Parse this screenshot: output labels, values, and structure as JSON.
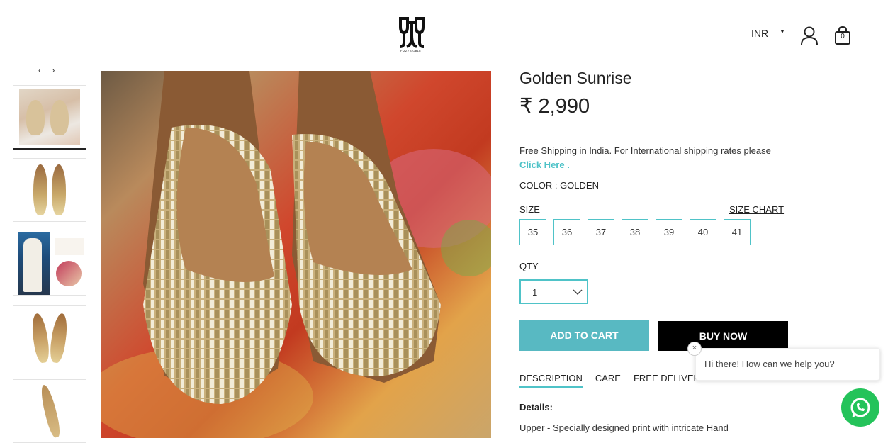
{
  "header": {
    "logo_text": "FIZZY GOBLET",
    "currency": "INR",
    "cart_count": "0"
  },
  "thumbnails": {
    "prev_icon": "chevron-left-icon",
    "next_icon": "chevron-right-icon",
    "items": [
      "thumbnail-1",
      "thumbnail-2",
      "thumbnail-3",
      "thumbnail-4",
      "thumbnail-5"
    ]
  },
  "product": {
    "title": "Golden Sunrise",
    "price": "₹ 2,990",
    "shipping_text": "Free Shipping in India. For International shipping rates please",
    "shipping_link": "Click Here .",
    "color_label": "COLOR : GOLDEN",
    "size_label": "SIZE",
    "size_chart_label": "SIZE CHART",
    "sizes": [
      "35",
      "36",
      "37",
      "38",
      "39",
      "40",
      "41"
    ],
    "qty_label": "QTY",
    "qty_value": "1",
    "add_to_cart": "ADD TO CART",
    "buy_now": "BUY NOW"
  },
  "tabs": [
    "DESCRIPTION",
    "CARE",
    "FREE DELIVERY AND RETURNS"
  ],
  "details": {
    "label": "Details:",
    "text": "Upper - Specially designed print with intricate Hand"
  },
  "chat": {
    "message": "Hi there! How can we help you?",
    "close": "×"
  },
  "colors": {
    "accent": "#4fc3c8",
    "add_to_cart_bg": "#58b9c2",
    "buy_now_bg": "#000000",
    "whatsapp": "#24c35a"
  }
}
